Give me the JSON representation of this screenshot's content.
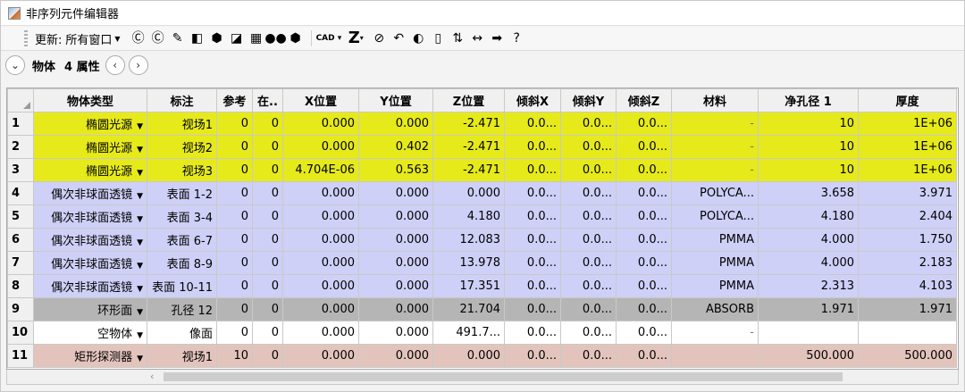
{
  "window": {
    "title": "非序列元件编辑器"
  },
  "toolbar": {
    "update_label": "更新:",
    "update_value": "所有窗口",
    "icons": [
      {
        "name": "refresh-c-icon",
        "glyph": "Ⓒ"
      },
      {
        "name": "refresh-c-all-icon",
        "glyph": "Ⓒ"
      },
      {
        "name": "ray-trace-icon",
        "glyph": "✎"
      },
      {
        "name": "shaded-model-icon",
        "glyph": "◧"
      },
      {
        "name": "solid-model-icon",
        "glyph": "⬢"
      },
      {
        "name": "cube-view-icon",
        "glyph": "◪"
      },
      {
        "name": "matrix-view-icon",
        "glyph": "▦"
      },
      {
        "name": "layout-icon",
        "glyph": "●●"
      },
      {
        "name": "hexagon-icon",
        "glyph": "⬢"
      }
    ],
    "cad_label": "CAD",
    "z_label": "Z",
    "icons2": [
      {
        "name": "no-icon",
        "glyph": "⊘"
      },
      {
        "name": "undo-icon",
        "glyph": "↶"
      },
      {
        "name": "toggle-icon",
        "glyph": "◐"
      },
      {
        "name": "page-icon",
        "glyph": "▯"
      },
      {
        "name": "swap-icon",
        "glyph": "⇅"
      },
      {
        "name": "double-arrow-icon",
        "glyph": "↔"
      },
      {
        "name": "right-arrow-icon",
        "glyph": "➡"
      },
      {
        "name": "help-icon",
        "glyph": "?"
      }
    ]
  },
  "subbar": {
    "object_label": "物体",
    "count_label": "4 属性"
  },
  "table": {
    "columns": [
      "",
      "物体类型",
      "标注",
      "参考",
      "在..",
      "X位置",
      "Y位置",
      "Z位置",
      "倾斜X",
      "倾斜Y",
      "倾斜Z",
      "材料",
      "净孔径 1",
      "厚度"
    ],
    "rows": [
      {
        "n": "1",
        "style": "yellow",
        "type": "椭圆光源",
        "label": "视场1",
        "ref": "0",
        "in": "0",
        "x": "0.000",
        "y": "0.000",
        "z": "-2.471",
        "tx": "0.0...",
        "ty": "0.0...",
        "tz": "0.0...",
        "mat": "-",
        "clear": "10",
        "thick": "1E+06"
      },
      {
        "n": "2",
        "style": "yellow",
        "type": "椭圆光源",
        "label": "视场2",
        "ref": "0",
        "in": "0",
        "x": "0.000",
        "y": "0.402",
        "z": "-2.471",
        "tx": "0.0...",
        "ty": "0.0...",
        "tz": "0.0...",
        "mat": "-",
        "clear": "10",
        "thick": "1E+06"
      },
      {
        "n": "3",
        "style": "yellow",
        "type": "椭圆光源",
        "label": "视场3",
        "ref": "0",
        "in": "0",
        "x": "4.704E-06",
        "y": "0.563",
        "z": "-2.471",
        "tx": "0.0...",
        "ty": "0.0...",
        "tz": "0.0...",
        "mat": "-",
        "clear": "10",
        "thick": "1E+06"
      },
      {
        "n": "4",
        "style": "lavender",
        "type": "偶次非球面透镜",
        "label": "表面 1-2",
        "ref": "0",
        "in": "0",
        "x": "0.000",
        "y": "0.000",
        "z": "0.000",
        "tx": "0.0...",
        "ty": "0.0...",
        "tz": "0.0...",
        "mat": "POLYCA...",
        "clear": "3.658",
        "thick": "3.971"
      },
      {
        "n": "5",
        "style": "lavender",
        "type": "偶次非球面透镜",
        "label": "表面 3-4",
        "ref": "0",
        "in": "0",
        "x": "0.000",
        "y": "0.000",
        "z": "4.180",
        "tx": "0.0...",
        "ty": "0.0...",
        "tz": "0.0...",
        "mat": "POLYCA...",
        "clear": "4.180",
        "thick": "2.404"
      },
      {
        "n": "6",
        "style": "lavender",
        "type": "偶次非球面透镜",
        "label": "表面 6-7",
        "ref": "0",
        "in": "0",
        "x": "0.000",
        "y": "0.000",
        "z": "12.083",
        "tx": "0.0...",
        "ty": "0.0...",
        "tz": "0.0...",
        "mat": "PMMA",
        "clear": "4.000",
        "thick": "1.750"
      },
      {
        "n": "7",
        "style": "lavender",
        "type": "偶次非球面透镜",
        "label": "表面 8-9",
        "ref": "0",
        "in": "0",
        "x": "0.000",
        "y": "0.000",
        "z": "13.978",
        "tx": "0.0...",
        "ty": "0.0...",
        "tz": "0.0...",
        "mat": "PMMA",
        "clear": "4.000",
        "thick": "2.183"
      },
      {
        "n": "8",
        "style": "lavender",
        "type": "偶次非球面透镜",
        "label": "表面 10-11",
        "ref": "0",
        "in": "0",
        "x": "0.000",
        "y": "0.000",
        "z": "17.351",
        "tx": "0.0...",
        "ty": "0.0...",
        "tz": "0.0...",
        "mat": "PMMA",
        "clear": "2.313",
        "thick": "4.103"
      },
      {
        "n": "9",
        "style": "gray",
        "type": "环形面",
        "label": "孔径 12",
        "ref": "0",
        "in": "0",
        "x": "0.000",
        "y": "0.000",
        "z": "21.704",
        "tx": "0.0...",
        "ty": "0.0...",
        "tz": "0.0...",
        "mat": "ABSORB",
        "clear": "1.971",
        "thick": "1.971"
      },
      {
        "n": "10",
        "style": "white",
        "type": "空物体",
        "label": "像面",
        "ref": "0",
        "in": "0",
        "x": "0.000",
        "y": "0.000",
        "z": "491.7...",
        "tx": "0.0...",
        "ty": "0.0...",
        "tz": "0.0...",
        "mat": "-",
        "clear": "",
        "thick": ""
      },
      {
        "n": "11",
        "style": "pink",
        "type": "矩形探测器",
        "label": "视场1",
        "ref": "10",
        "in": "0",
        "x": "0.000",
        "y": "0.000",
        "z": "0.000",
        "tx": "0.0...",
        "ty": "0.0...",
        "tz": "0.0...",
        "mat": "",
        "clear": "500.000",
        "thick": "500.000"
      }
    ]
  },
  "colors": {
    "yellow": "#e6ea1a",
    "lavender": "#cfd0f7",
    "gray": "#b5b5b5",
    "pink": "#e3c4bd"
  }
}
